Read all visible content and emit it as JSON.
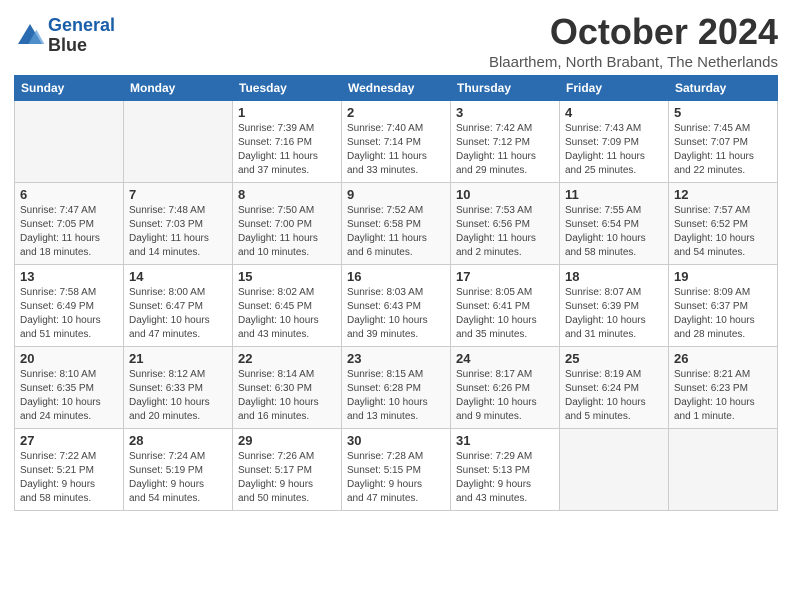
{
  "header": {
    "logo_line1": "General",
    "logo_line2": "Blue",
    "month": "October 2024",
    "location": "Blaarthem, North Brabant, The Netherlands"
  },
  "weekdays": [
    "Sunday",
    "Monday",
    "Tuesday",
    "Wednesday",
    "Thursday",
    "Friday",
    "Saturday"
  ],
  "weeks": [
    [
      {
        "day": "",
        "info": ""
      },
      {
        "day": "",
        "info": ""
      },
      {
        "day": "1",
        "info": "Sunrise: 7:39 AM\nSunset: 7:16 PM\nDaylight: 11 hours\nand 37 minutes."
      },
      {
        "day": "2",
        "info": "Sunrise: 7:40 AM\nSunset: 7:14 PM\nDaylight: 11 hours\nand 33 minutes."
      },
      {
        "day": "3",
        "info": "Sunrise: 7:42 AM\nSunset: 7:12 PM\nDaylight: 11 hours\nand 29 minutes."
      },
      {
        "day": "4",
        "info": "Sunrise: 7:43 AM\nSunset: 7:09 PM\nDaylight: 11 hours\nand 25 minutes."
      },
      {
        "day": "5",
        "info": "Sunrise: 7:45 AM\nSunset: 7:07 PM\nDaylight: 11 hours\nand 22 minutes."
      }
    ],
    [
      {
        "day": "6",
        "info": "Sunrise: 7:47 AM\nSunset: 7:05 PM\nDaylight: 11 hours\nand 18 minutes."
      },
      {
        "day": "7",
        "info": "Sunrise: 7:48 AM\nSunset: 7:03 PM\nDaylight: 11 hours\nand 14 minutes."
      },
      {
        "day": "8",
        "info": "Sunrise: 7:50 AM\nSunset: 7:00 PM\nDaylight: 11 hours\nand 10 minutes."
      },
      {
        "day": "9",
        "info": "Sunrise: 7:52 AM\nSunset: 6:58 PM\nDaylight: 11 hours\nand 6 minutes."
      },
      {
        "day": "10",
        "info": "Sunrise: 7:53 AM\nSunset: 6:56 PM\nDaylight: 11 hours\nand 2 minutes."
      },
      {
        "day": "11",
        "info": "Sunrise: 7:55 AM\nSunset: 6:54 PM\nDaylight: 10 hours\nand 58 minutes."
      },
      {
        "day": "12",
        "info": "Sunrise: 7:57 AM\nSunset: 6:52 PM\nDaylight: 10 hours\nand 54 minutes."
      }
    ],
    [
      {
        "day": "13",
        "info": "Sunrise: 7:58 AM\nSunset: 6:49 PM\nDaylight: 10 hours\nand 51 minutes."
      },
      {
        "day": "14",
        "info": "Sunrise: 8:00 AM\nSunset: 6:47 PM\nDaylight: 10 hours\nand 47 minutes."
      },
      {
        "day": "15",
        "info": "Sunrise: 8:02 AM\nSunset: 6:45 PM\nDaylight: 10 hours\nand 43 minutes."
      },
      {
        "day": "16",
        "info": "Sunrise: 8:03 AM\nSunset: 6:43 PM\nDaylight: 10 hours\nand 39 minutes."
      },
      {
        "day": "17",
        "info": "Sunrise: 8:05 AM\nSunset: 6:41 PM\nDaylight: 10 hours\nand 35 minutes."
      },
      {
        "day": "18",
        "info": "Sunrise: 8:07 AM\nSunset: 6:39 PM\nDaylight: 10 hours\nand 31 minutes."
      },
      {
        "day": "19",
        "info": "Sunrise: 8:09 AM\nSunset: 6:37 PM\nDaylight: 10 hours\nand 28 minutes."
      }
    ],
    [
      {
        "day": "20",
        "info": "Sunrise: 8:10 AM\nSunset: 6:35 PM\nDaylight: 10 hours\nand 24 minutes."
      },
      {
        "day": "21",
        "info": "Sunrise: 8:12 AM\nSunset: 6:33 PM\nDaylight: 10 hours\nand 20 minutes."
      },
      {
        "day": "22",
        "info": "Sunrise: 8:14 AM\nSunset: 6:30 PM\nDaylight: 10 hours\nand 16 minutes."
      },
      {
        "day": "23",
        "info": "Sunrise: 8:15 AM\nSunset: 6:28 PM\nDaylight: 10 hours\nand 13 minutes."
      },
      {
        "day": "24",
        "info": "Sunrise: 8:17 AM\nSunset: 6:26 PM\nDaylight: 10 hours\nand 9 minutes."
      },
      {
        "day": "25",
        "info": "Sunrise: 8:19 AM\nSunset: 6:24 PM\nDaylight: 10 hours\nand 5 minutes."
      },
      {
        "day": "26",
        "info": "Sunrise: 8:21 AM\nSunset: 6:23 PM\nDaylight: 10 hours\nand 1 minute."
      }
    ],
    [
      {
        "day": "27",
        "info": "Sunrise: 7:22 AM\nSunset: 5:21 PM\nDaylight: 9 hours\nand 58 minutes."
      },
      {
        "day": "28",
        "info": "Sunrise: 7:24 AM\nSunset: 5:19 PM\nDaylight: 9 hours\nand 54 minutes."
      },
      {
        "day": "29",
        "info": "Sunrise: 7:26 AM\nSunset: 5:17 PM\nDaylight: 9 hours\nand 50 minutes."
      },
      {
        "day": "30",
        "info": "Sunrise: 7:28 AM\nSunset: 5:15 PM\nDaylight: 9 hours\nand 47 minutes."
      },
      {
        "day": "31",
        "info": "Sunrise: 7:29 AM\nSunset: 5:13 PM\nDaylight: 9 hours\nand 43 minutes."
      },
      {
        "day": "",
        "info": ""
      },
      {
        "day": "",
        "info": ""
      }
    ]
  ]
}
